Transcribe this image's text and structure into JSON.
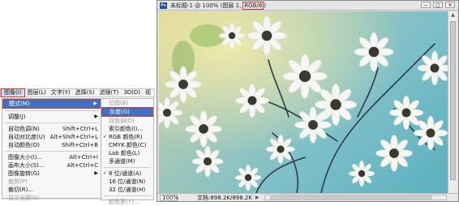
{
  "menubar": {
    "items": [
      {
        "label": "图像(I)",
        "active": true
      },
      {
        "label": "图层(L)"
      },
      {
        "label": "文字(Y)"
      },
      {
        "label": "选择(S)"
      },
      {
        "label": "滤镜(T)"
      },
      {
        "label": "3D(D)"
      },
      {
        "label": "视"
      }
    ]
  },
  "image_menu": {
    "mode": "模式(M)",
    "adjust": "调整(J)",
    "auto_tone": "自动色调(N)",
    "auto_tone_sc": "Shift+Ctrl+L",
    "auto_contrast": "自动对比度(U)",
    "auto_contrast_sc": "Alt+Shift+Ctrl+L",
    "auto_color": "自动颜色(O)",
    "auto_color_sc": "Shift+Ctrl+B",
    "image_size": "图像大小(I)...",
    "image_size_sc": "Alt+Ctrl+I",
    "canvas_size": "画布大小(S)...",
    "canvas_size_sc": "Alt+Ctrl+C",
    "rotate": "图像旋转(G)",
    "crop": "裁剪(P)",
    "trim": "裁切(R)...",
    "reveal_all": "显示全部(V)"
  },
  "mode_menu": {
    "bitmap": "位图(B)",
    "grayscale": "灰度(G)",
    "duotone": "双色调(D)",
    "indexed": "索引颜色(I)...",
    "rgb": "RGB 颜色(R)",
    "cmyk": "CMYK 颜色(C)",
    "lab": "Lab 颜色(L)",
    "multichannel": "多通道(M)",
    "bit8": "8 位/通道(A)",
    "bit16": "16 位/通道(N)",
    "bit32": "32 位/通道(H)",
    "color_table": "颜色表(T)..."
  },
  "document": {
    "icon": "Ps",
    "title": "未标题-1 @ 100% (图层 1, ",
    "mode": "RGB/8",
    "title_end": ")",
    "zoom": "100%",
    "info": "文档:898.2K/898.2K"
  },
  "colors": {
    "accent": "#3a73c6",
    "highlight_border": "#d9342b"
  }
}
